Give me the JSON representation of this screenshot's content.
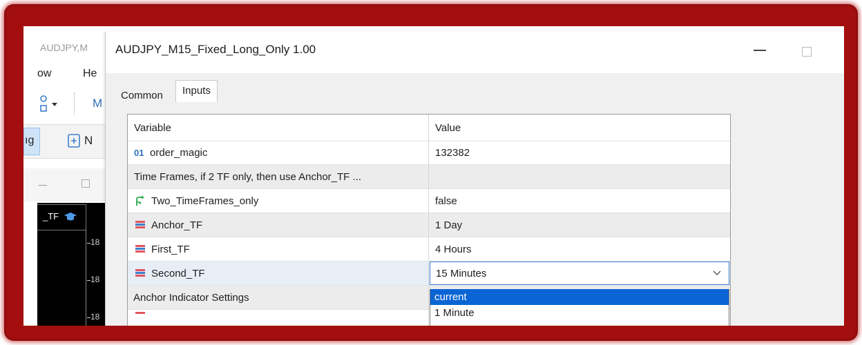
{
  "background_window": {
    "title": "AUDJPY,M",
    "menu": [
      "ow",
      "He"
    ],
    "toolbar_label": "M",
    "toolbar2_labels": [
      "ıg",
      "N"
    ],
    "chart_indicator_label": "_TF",
    "axis_ticks": [
      "18",
      "18",
      "18"
    ]
  },
  "dialog": {
    "title": "AUDJPY_M15_Fixed_Long_Only 1.00",
    "tabs": [
      {
        "label": "Common",
        "active": false
      },
      {
        "label": "Inputs",
        "active": true
      }
    ],
    "table": {
      "headers": {
        "variable": "Variable",
        "value": "Value"
      },
      "rows": [
        {
          "icon": "int-icon",
          "icon_text": "01",
          "variable": "order_magic",
          "value": "132382",
          "shaded": false
        },
        {
          "icon": "",
          "icon_text": "",
          "variable": "Time Frames, if 2 TF only, then use Anchor_TF ...",
          "value": "",
          "shaded": true
        },
        {
          "icon": "bool-icon",
          "icon_text": "",
          "variable": "Two_TimeFrames_only",
          "value": "false",
          "shaded": false
        },
        {
          "icon": "enum-icon",
          "icon_text": "",
          "variable": "Anchor_TF",
          "value": "1 Day",
          "shaded": true
        },
        {
          "icon": "enum-icon",
          "icon_text": "",
          "variable": "First_TF",
          "value": "4 Hours",
          "shaded": false
        },
        {
          "icon": "enum-icon",
          "icon_text": "",
          "variable": "Second_TF",
          "value": "15 Minutes",
          "shaded": true,
          "editing": true
        },
        {
          "icon": "",
          "icon_text": "",
          "variable": "Anchor Indicator Settings",
          "value": "",
          "shaded": true
        }
      ]
    },
    "dropdown": {
      "selected_value": "15 Minutes",
      "options": [
        {
          "label": "current",
          "highlighted": true
        },
        {
          "label": "1 Minute",
          "highlighted": false
        }
      ]
    }
  },
  "colors": {
    "frame_red": "#a30f0f",
    "selection_blue": "#0a64d4",
    "focus_border": "#3a7fd0",
    "enum_icon_red": "#e0555f",
    "enum_icon_blue": "#3d7fcc",
    "bool_icon_green": "#2aa84a"
  }
}
